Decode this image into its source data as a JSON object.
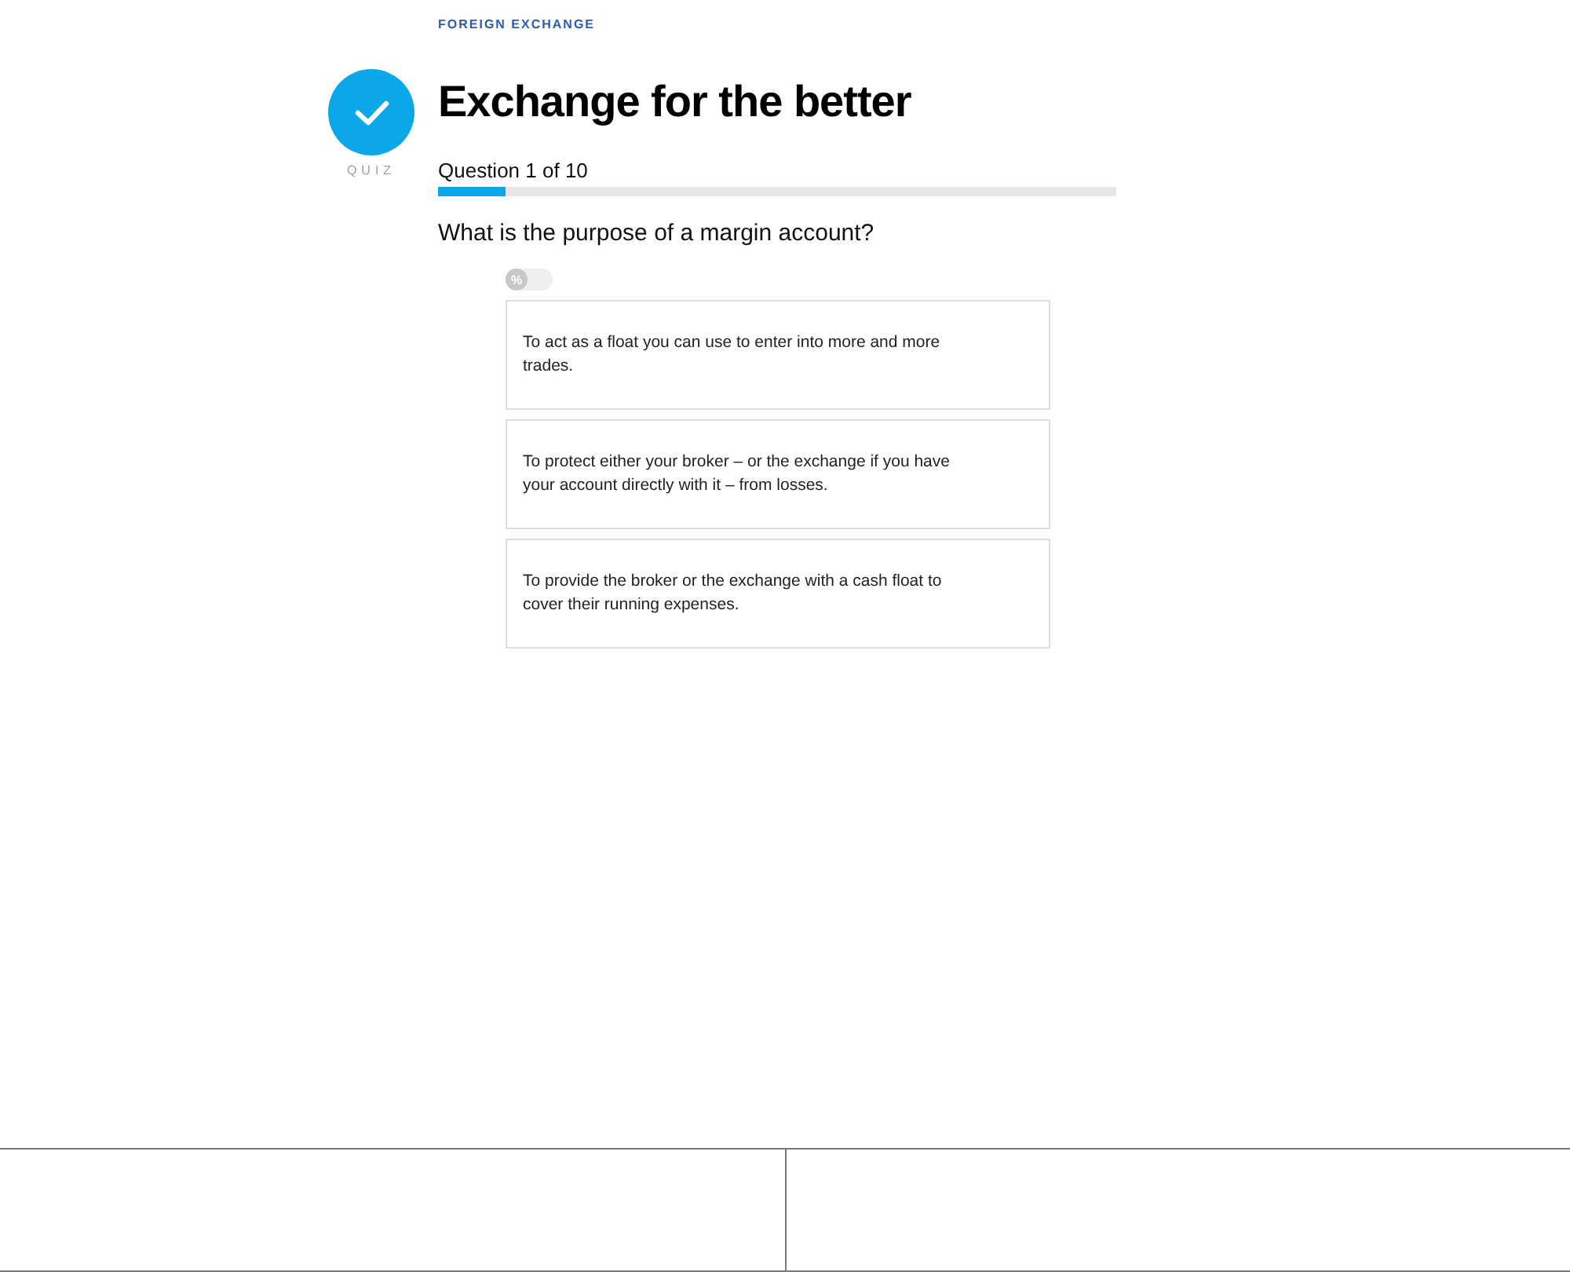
{
  "category": "FOREIGN EXCHANGE",
  "badge": {
    "label": "QUIZ"
  },
  "title": "Exchange for the better",
  "progress": {
    "text": "Question 1 of 10",
    "level": 0.1
  },
  "question": "What is the purpose of a margin account?",
  "percent_toggle": {
    "label": "%",
    "on": false
  },
  "answers": [
    {
      "text": "To act as a float you can use to enter into more and more trades.",
      "selected": false
    },
    {
      "text": "To protect either your broker – or the exchange if you have your account directly with it – from losses.",
      "selected": false
    },
    {
      "text": "To provide the broker or the exchange with a cash float to cover their running expenses.",
      "selected": false
    }
  ]
}
